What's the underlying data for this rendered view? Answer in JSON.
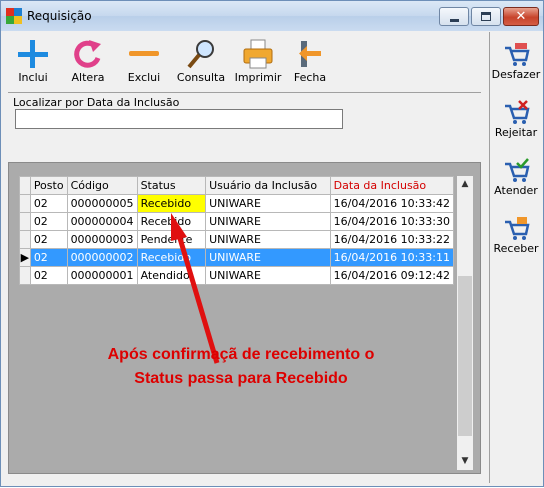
{
  "window": {
    "title": "Requisição",
    "close_glyph": "✕"
  },
  "toolbar": {
    "items": [
      {
        "label": "Inclui",
        "icon": "plus-icon"
      },
      {
        "label": "Altera",
        "icon": "refresh-icon"
      },
      {
        "label": "Exclui",
        "icon": "minus-icon"
      },
      {
        "label": "Consulta",
        "icon": "magnifier-icon"
      },
      {
        "label": "Imprimir",
        "icon": "printer-icon"
      },
      {
        "label": "Fecha",
        "icon": "exit-door-icon"
      }
    ]
  },
  "search": {
    "label": "Localizar por Data da Inclusão",
    "value": ""
  },
  "grid": {
    "columns": [
      "Posto",
      "Código",
      "Status",
      "Usuário da Inclusão",
      "Data da Inclusão"
    ],
    "rows": [
      {
        "posto": "02",
        "codigo": "000000005",
        "status": "Recebido",
        "usuario": "UNIWARE",
        "data": "16/04/2016 10:33:42"
      },
      {
        "posto": "02",
        "codigo": "000000004",
        "status": "Recebido",
        "usuario": "UNIWARE",
        "data": "16/04/2016 10:33:30"
      },
      {
        "posto": "02",
        "codigo": "000000003",
        "status": "Pendente",
        "usuario": "UNIWARE",
        "data": "16/04/2016 10:33:22"
      },
      {
        "posto": "02",
        "codigo": "000000002",
        "status": "Recebido",
        "usuario": "UNIWARE",
        "data": "16/04/2016 10:33:11"
      },
      {
        "posto": "02",
        "codigo": "000000001",
        "status": "Atendido",
        "usuario": "UNIWARE",
        "data": "16/04/2016 09:12:42"
      }
    ],
    "selected_row_indicator": "▶",
    "scroll_up": "▲",
    "scroll_down": "▼"
  },
  "side": {
    "items": [
      {
        "label": "Desfazer",
        "icon": "cart-undo-icon"
      },
      {
        "label": "Rejeitar",
        "icon": "cart-reject-icon"
      },
      {
        "label": "Atender",
        "icon": "cart-check-icon"
      },
      {
        "label": "Receber",
        "icon": "cart-receive-icon"
      }
    ]
  },
  "annotation": {
    "line1": "Após confirmaçã de recebimento o",
    "line2": "Status passa para Recebido"
  },
  "colors": {
    "selection": "#3399ff",
    "highlight": "#ffff00",
    "annotation": "#dd0000",
    "header_red": "#d40000"
  }
}
